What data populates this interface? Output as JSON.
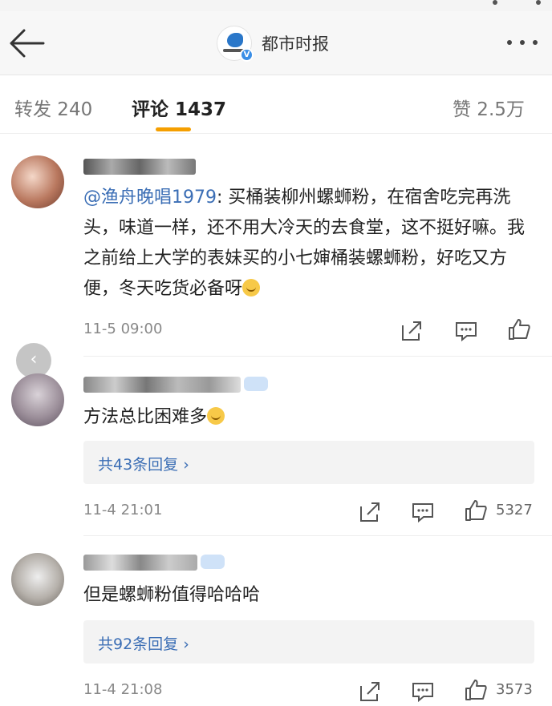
{
  "status_bar": {
    "dots": 2
  },
  "nav": {
    "title": "都市时报",
    "verified_mark": "V",
    "back_icon": "back-arrow-icon",
    "more_icon": "more-dots-icon"
  },
  "tabs": {
    "repost": "转发 240",
    "comments": "评论 1437",
    "likes": "赞 2.5万"
  },
  "accent_color": "#f59f00",
  "link_color": "#3b6eb5",
  "comments": [
    {
      "mention": "@渔舟晚唱1979",
      "text": ": 买桶装柳州螺蛳粉，在宿舍吃完再洗头，味道一样，还不用大冷天的去食堂，这不挺好嘛。我之前给上大学的表妹买的小七婶桶装螺蛳粉，好吃又方便，冬天吃货必备呀",
      "time": "11-5 09:00",
      "likes": ""
    },
    {
      "text": "方法总比困难多",
      "reply_label": "共43条回复 ›",
      "time": "11-4 21:01",
      "likes": "5327"
    },
    {
      "text": "但是螺蛳粉值得哈哈哈",
      "reply_label": "共92条回复 ›",
      "time": "11-4 21:08",
      "likes": "3573"
    }
  ],
  "float_button": {
    "label": "‹"
  }
}
